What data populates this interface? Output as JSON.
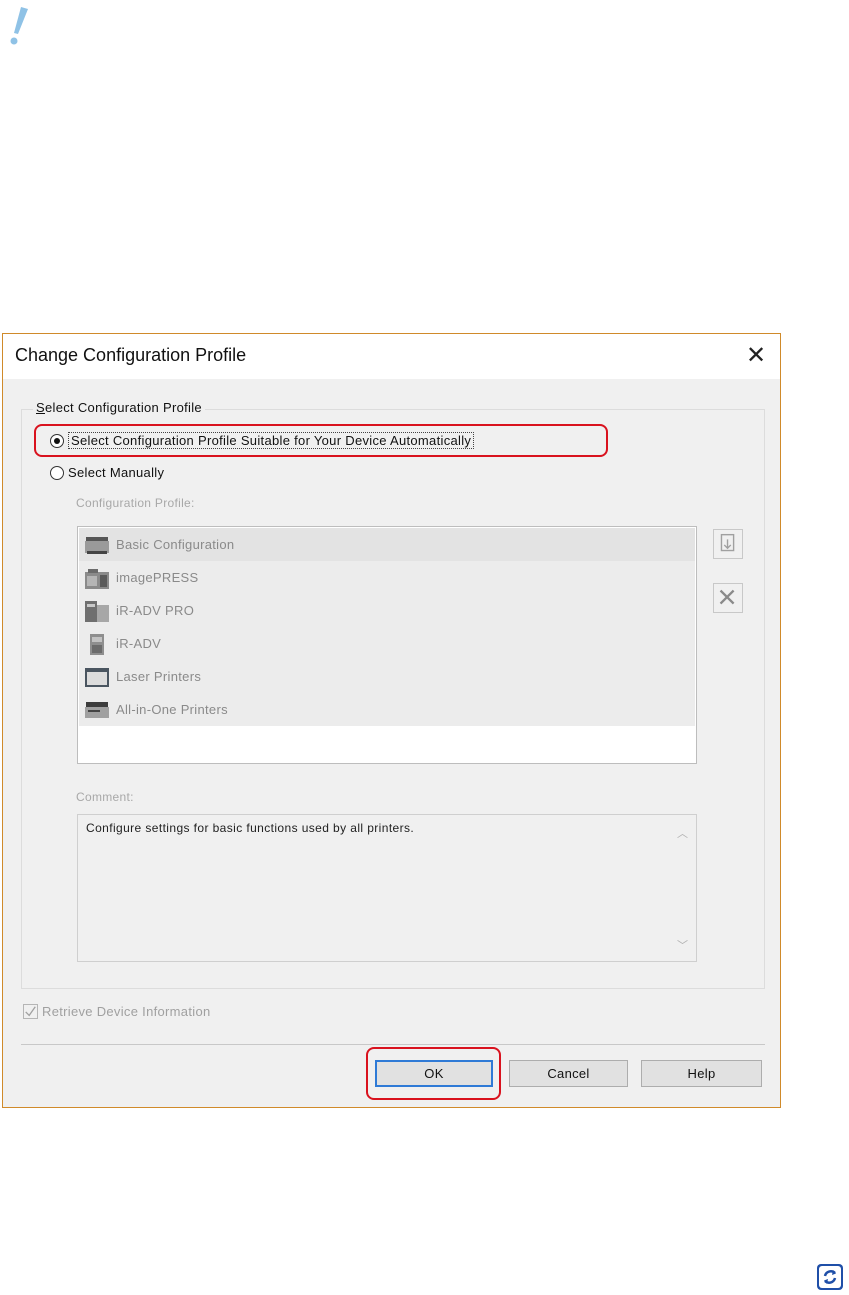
{
  "dialog": {
    "title": "Change Configuration Profile",
    "close_label": "✕",
    "group_label": "Select Configuration Profile",
    "radio_auto_label": "Select Configuration Profile Suitable for Your Device Automatically",
    "radio_manual_label": "Select Manually",
    "auto_selected": true,
    "profile_list_label": "Configuration Profile:",
    "profiles": [
      {
        "label": "Basic Configuration",
        "icon": "basic-printer-icon",
        "selected": true
      },
      {
        "label": "imagePRESS",
        "icon": "production-press-icon",
        "selected": false
      },
      {
        "label": "iR-ADV PRO",
        "icon": "production-printer-icon",
        "selected": false
      },
      {
        "label": "iR-ADV",
        "icon": "multifunction-printer-icon",
        "selected": false
      },
      {
        "label": "Laser Printers",
        "icon": "laser-printer-icon",
        "selected": false
      },
      {
        "label": "All-in-One Printers",
        "icon": "all-in-one-printer-icon",
        "selected": false
      }
    ],
    "comment_label": "Comment:",
    "comment_text": "Configure settings for basic functions used by all printers.",
    "retrieve_label": "Retrieve Device Information",
    "retrieve_checked": true,
    "buttons": {
      "ok": "OK",
      "cancel": "Cancel",
      "help": "Help"
    },
    "highlight_color": "#d9121e",
    "accent_color": "#2f7ad6"
  }
}
